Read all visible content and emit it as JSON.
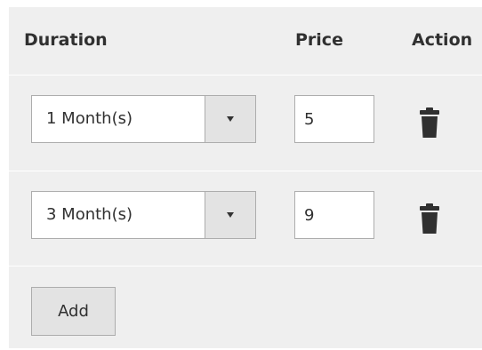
{
  "table": {
    "headers": {
      "duration": "Duration",
      "price": "Price",
      "action": "Action"
    },
    "rows": [
      {
        "duration": "1 Month(s)",
        "price": "5",
        "action_icon": "trash-icon"
      },
      {
        "duration": "3 Month(s)",
        "price": "9",
        "action_icon": "trash-icon"
      }
    ]
  },
  "add_label": "Add",
  "colors": {
    "panel_bg": "#efefef",
    "divider": "#ffffff",
    "border": "#adadad",
    "toggle_bg": "#e3e3e3",
    "icon": "#303030",
    "text": "#303030"
  }
}
